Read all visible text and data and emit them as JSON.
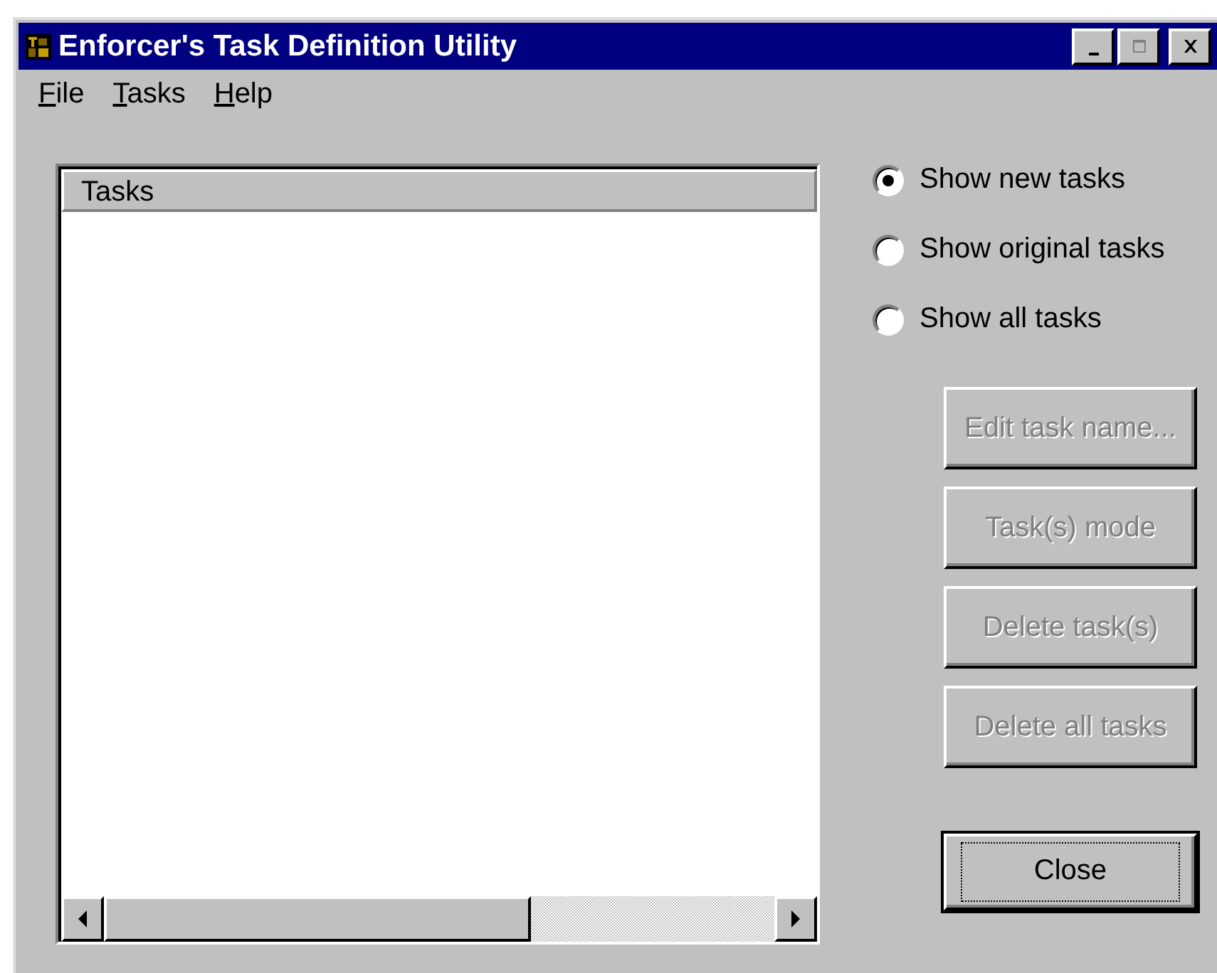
{
  "window": {
    "title": "Enforcer's Task Definition Utility",
    "controls": [
      {
        "kind": "minimize",
        "disabled": false
      },
      {
        "kind": "maximize",
        "disabled": true
      },
      {
        "kind": "close",
        "disabled": false
      }
    ]
  },
  "menu": [
    {
      "label": "File"
    },
    {
      "label": "Tasks"
    },
    {
      "label": "Help"
    }
  ],
  "list": {
    "columns": [
      "Tasks"
    ]
  },
  "filters": [
    {
      "label": "Show new tasks",
      "selected": true
    },
    {
      "label": "Show original tasks",
      "selected": false
    },
    {
      "label": "Show all tasks",
      "selected": false
    }
  ],
  "buttons": [
    {
      "label": "Edit task name...",
      "disabled": true,
      "default": false
    },
    {
      "label": "Task(s) mode",
      "disabled": true,
      "default": false
    },
    {
      "label": "Delete task(s)",
      "disabled": true,
      "default": false
    },
    {
      "label": "Delete all tasks",
      "disabled": true,
      "default": false
    },
    {
      "label": "Close",
      "disabled": false,
      "default": true
    }
  ]
}
